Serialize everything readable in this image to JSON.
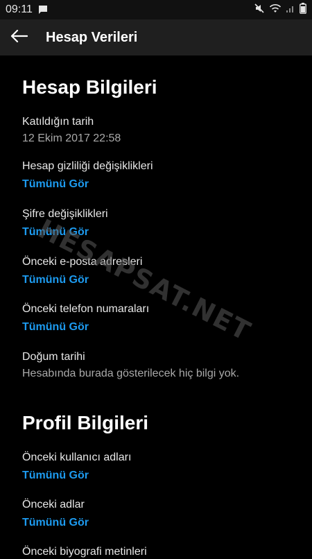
{
  "status_bar": {
    "time": "09:11"
  },
  "app_bar": {
    "title": "Hesap Verileri"
  },
  "sections": [
    {
      "title": "Hesap Bilgileri",
      "items": [
        {
          "label": "Katıldığın tarih",
          "value": "12 Ekim 2017 22:58"
        },
        {
          "label": "Hesap gizliliği değişiklikleri",
          "link": "Tümünü Gör"
        },
        {
          "label": "Şifre değişiklikleri",
          "link": "Tümünü Gör"
        },
        {
          "label": "Önceki e-posta adresleri",
          "link": "Tümünü Gör"
        },
        {
          "label": "Önceki telefon numaraları",
          "link": "Tümünü Gör"
        },
        {
          "label": "Doğum tarihi",
          "value": "Hesabında burada gösterilecek hiç bilgi yok."
        }
      ]
    },
    {
      "title": "Profil Bilgileri",
      "items": [
        {
          "label": "Önceki kullanıcı adları",
          "link": "Tümünü Gör"
        },
        {
          "label": "Önceki adlar",
          "link": "Tümünü Gör"
        },
        {
          "label": "Önceki biyografi metinleri"
        }
      ]
    }
  ],
  "watermark": "HESAPSAT.NET",
  "colors": {
    "link": "#1d9bf0",
    "background": "#000000",
    "app_bar": "#1f1f1f"
  }
}
